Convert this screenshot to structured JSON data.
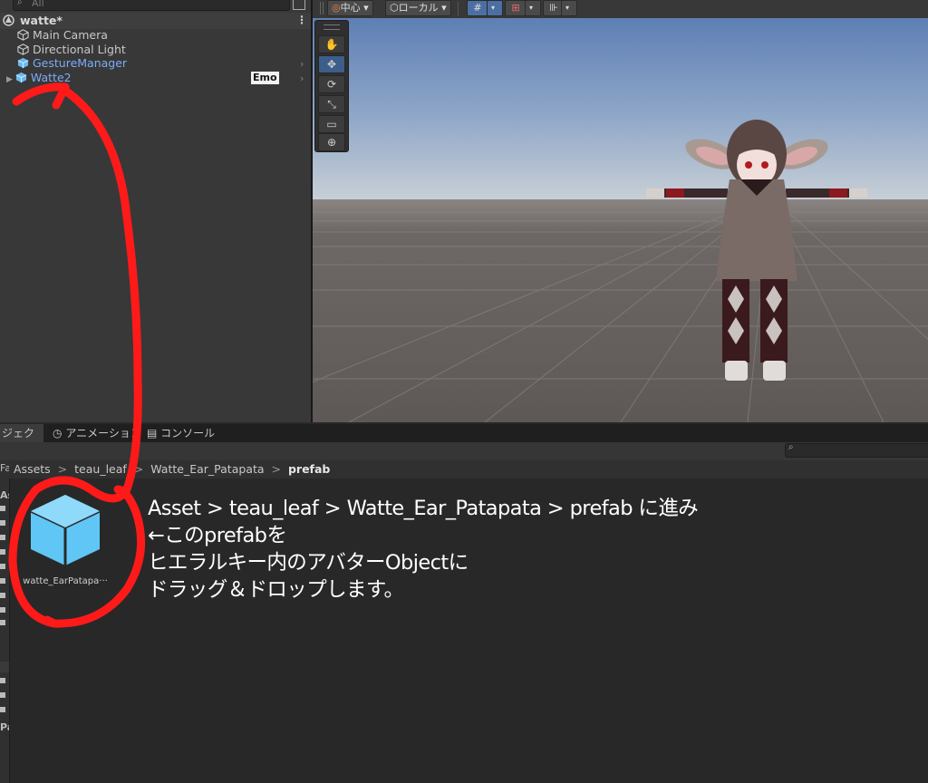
{
  "hierarchy": {
    "search_placeholder": "All",
    "scene_name": "watte*",
    "kebab": "⋮",
    "items": [
      {
        "label": "Main Camera",
        "color": "#c8c8c8"
      },
      {
        "label": "Directional Light",
        "color": "#c8c8c8"
      },
      {
        "label": "GestureManager",
        "color": "#7cacf8"
      },
      {
        "label": "Watte2",
        "color": "#7cacf8"
      }
    ],
    "emo_badge": "Emo"
  },
  "scene_toolbar": {
    "pivot_label": "中心",
    "space_label": "ローカル"
  },
  "bottom_tabs": {
    "project": "ジェクト",
    "animation": "アニメーション",
    "console": "コンソール"
  },
  "breadcrumb": {
    "parts": [
      "Assets",
      "teau_leaf",
      "Watte_Ear_Patapata",
      "prefab"
    ],
    "sep": ">"
  },
  "left_tree": {
    "chars": [
      "Fa",
      "As",
      "",
      "",
      "",
      "",
      "",
      "",
      "",
      "",
      "",
      "",
      "",
      "",
      "",
      "Pa"
    ]
  },
  "asset": {
    "label": "watte_EarPatapa···"
  },
  "instructions": {
    "line1": "Asset > teau_leaf > Watte_Ear_Patapata > prefab に進み",
    "line2": "←このprefabを",
    "line3": "ヒエラルキー内のアバターObjectに",
    "line4": "ドラッグ＆ドロップします。"
  },
  "colors": {
    "panel": "#383838",
    "selection_blue": "#7cacf8",
    "annotation_red": "#ff1a1a",
    "prefab_cube": "#5fc6f5"
  }
}
